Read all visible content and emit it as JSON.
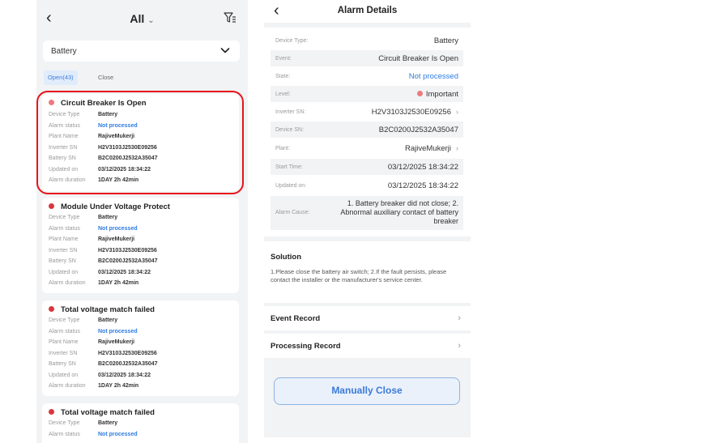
{
  "alarm_list": {
    "back_glyph": "‹",
    "filter_title": "All",
    "filter_chev": "⌄",
    "device_dropdown": "Battery",
    "tabs": {
      "open": "Open(43)",
      "close": "Close"
    },
    "labels": {
      "device_type": "Device Type",
      "alarm_status": "Alarm status",
      "plant_name": "Plant Name",
      "inverter_sn": "Inverter SN",
      "battery_sn": "Battery SN",
      "updated_on": "Updated on",
      "alarm_duration": "Alarm duration"
    },
    "cards": [
      {
        "title": "Circuit Breaker Is Open",
        "device_type": "Battery",
        "alarm_status": "Not processed",
        "plant_name": "RajiveMukerji",
        "inverter_sn": "H2V3103J2530E09256",
        "battery_sn": "B2C0200J2532A35047",
        "updated_on": "03/12/2025 18:34:22",
        "alarm_duration": "1DAY 2h 42min"
      },
      {
        "title": "Module Under Voltage Protect",
        "device_type": "Battery",
        "alarm_status": "Not processed",
        "plant_name": "RajiveMukerji",
        "inverter_sn": "H2V3103J2530E09256",
        "battery_sn": "B2C0200J2532A35047",
        "updated_on": "03/12/2025 18:34:22",
        "alarm_duration": "1DAY 2h 42min"
      },
      {
        "title": "Total voltage match failed",
        "device_type": "Battery",
        "alarm_status": "Not processed",
        "plant_name": "RajiveMukerji",
        "inverter_sn": "H2V3103J2530E09256",
        "battery_sn": "B2C0200J2532A35047",
        "updated_on": "03/12/2025 18:34:22",
        "alarm_duration": "1DAY 2h 42min"
      },
      {
        "title": "Total voltage match failed",
        "device_type": "Battery",
        "alarm_status": "Not processed"
      }
    ]
  },
  "alarm_details": {
    "back_glyph": "‹",
    "title": "Alarm Details",
    "fields": {
      "device_type": {
        "label": "Device Type:",
        "value": "Battery"
      },
      "event": {
        "label": "Event:",
        "value": "Circuit Breaker Is Open"
      },
      "state": {
        "label": "State:",
        "value": "Not processed"
      },
      "level": {
        "label": "Level:",
        "value": "Important"
      },
      "inverter_sn": {
        "label": "Inverter SN:",
        "value": "H2V3103J2530E09256"
      },
      "device_sn": {
        "label": "Device SN:",
        "value": "B2C0200J2532A35047"
      },
      "plant": {
        "label": "Plant:",
        "value": "RajiveMukerji"
      },
      "start_time": {
        "label": "Start Time:",
        "value": "03/12/2025 18:34:22"
      },
      "updated_on": {
        "label": "Updated on:",
        "value": "03/12/2025 18:34:22"
      },
      "alarm_cause": {
        "label": "Alarm Cause:",
        "value": "1. Battery breaker did not close; 2. Abnormal auxiliary contact of battery breaker"
      }
    },
    "solution": {
      "title": "Solution",
      "text": "1.Please close the battery air switch; 2.If the fault persists, please contact the installer or the manufacturer's service center."
    },
    "event_record": "Event Record",
    "processing_record": "Processing Record",
    "record_chev": "›",
    "manual_close": "Manually Close"
  },
  "colors": {
    "accent_blue": "#2e7be0",
    "alarm_red": "#d9363e",
    "highlight_red": "#e8141c",
    "panel_bg": "#f2f3f5"
  }
}
